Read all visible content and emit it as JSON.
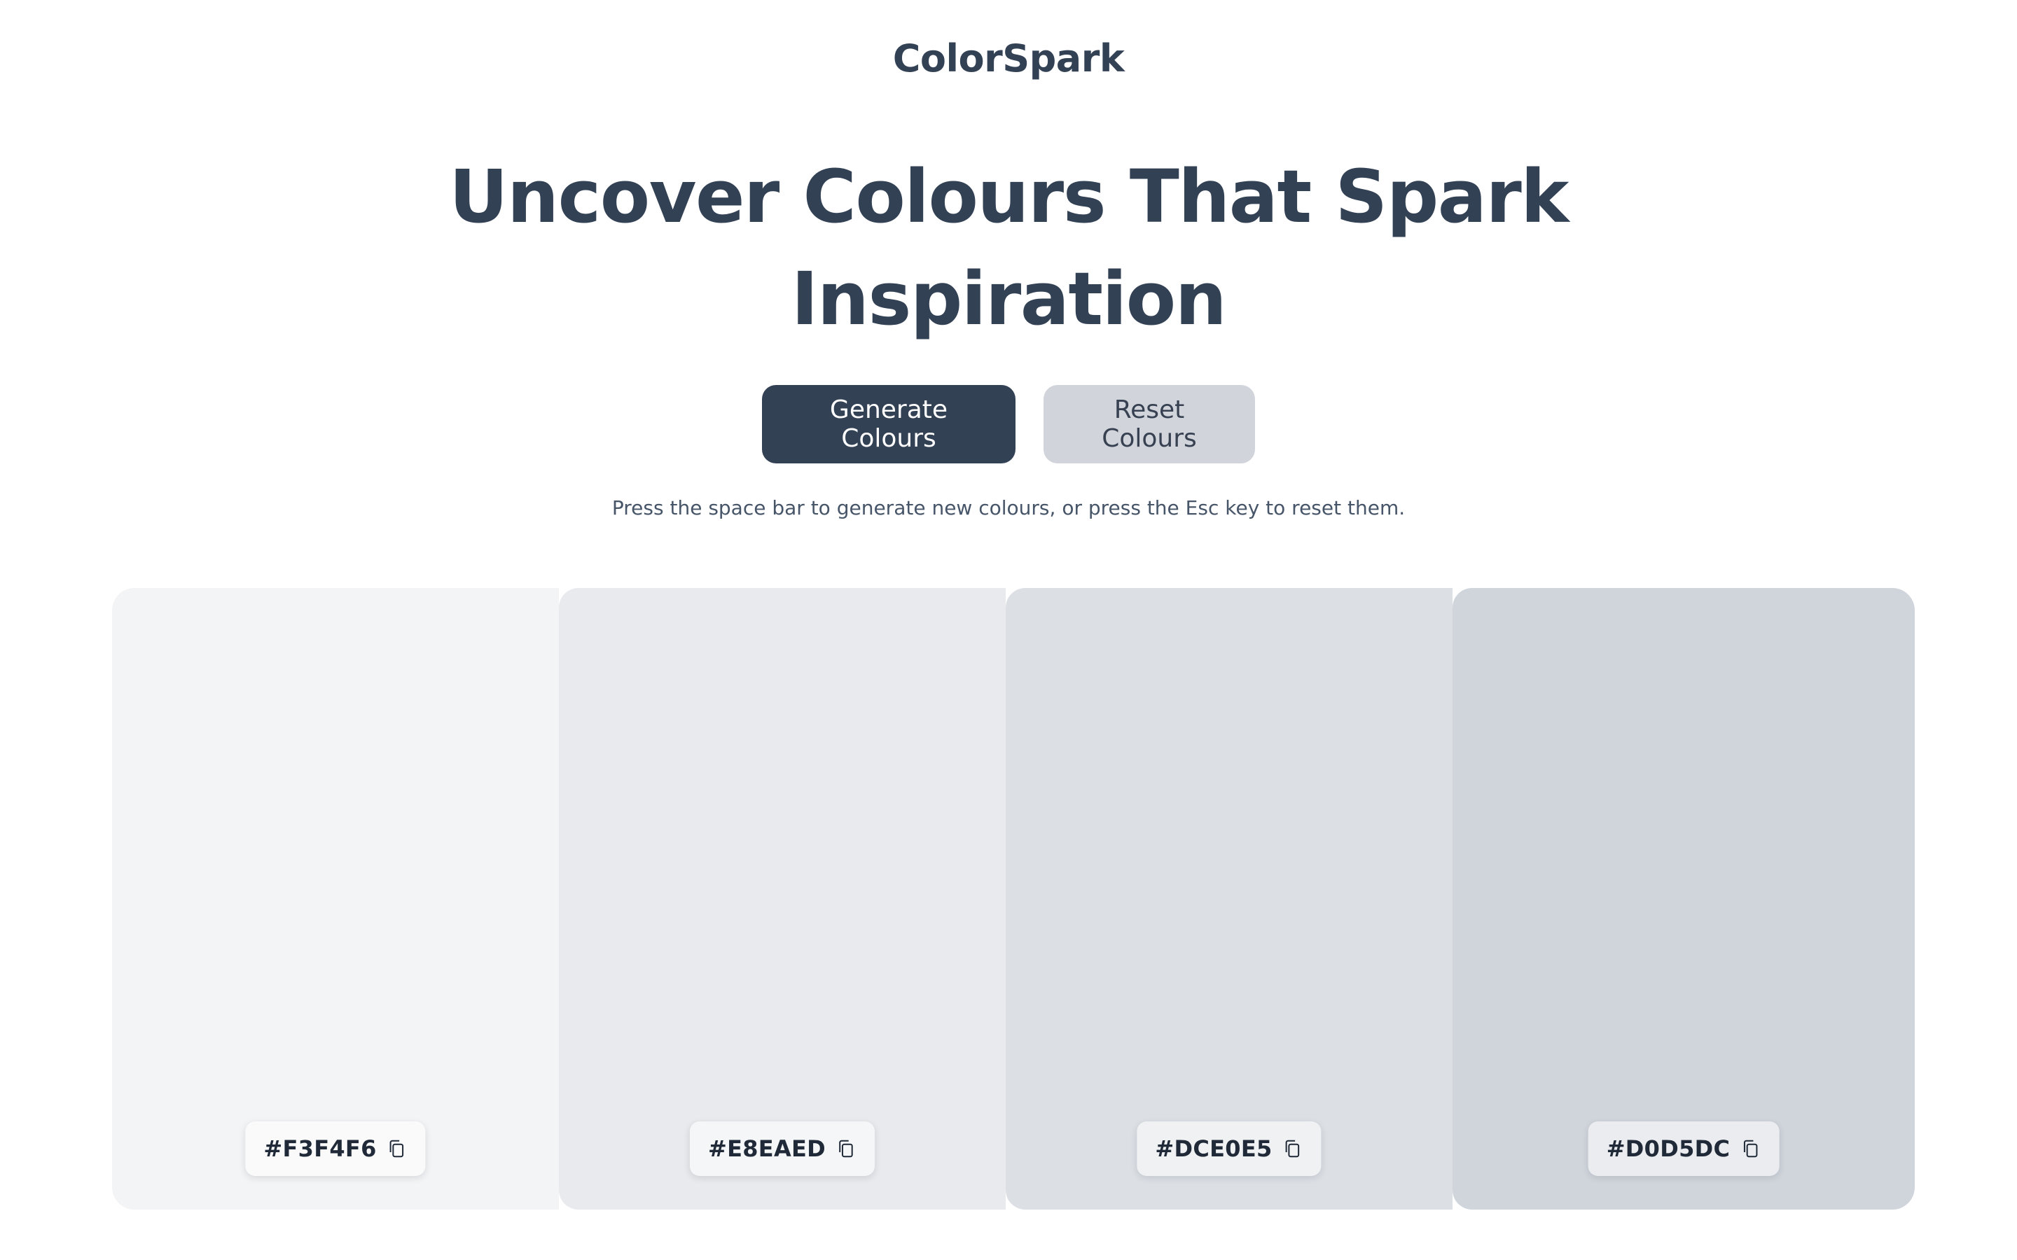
{
  "header": {
    "brand": "ColorSpark"
  },
  "hero": {
    "title": "Uncover Colours That Spark Inspiration"
  },
  "actions": {
    "generate_label": "Generate Colours",
    "reset_label": "Reset Colours",
    "hint": "Press the space bar to generate new colours, or press the Esc key to reset them."
  },
  "palette": {
    "swatches": [
      {
        "hex": "#F3F4F6",
        "color": "#F3F4F6",
        "icon": "copy-icon"
      },
      {
        "hex": "#E8EAED",
        "color": "#E8EAED",
        "icon": "copy-icon"
      },
      {
        "hex": "#DCE0E5",
        "color": "#DCE0E5",
        "icon": "copy-icon"
      },
      {
        "hex": "#D0D5DC",
        "color": "#D0D5DC",
        "icon": "copy-icon"
      }
    ]
  },
  "colors": {
    "text": "#334155",
    "primary_button": "#334155",
    "secondary_button": "#D1D5DB"
  }
}
